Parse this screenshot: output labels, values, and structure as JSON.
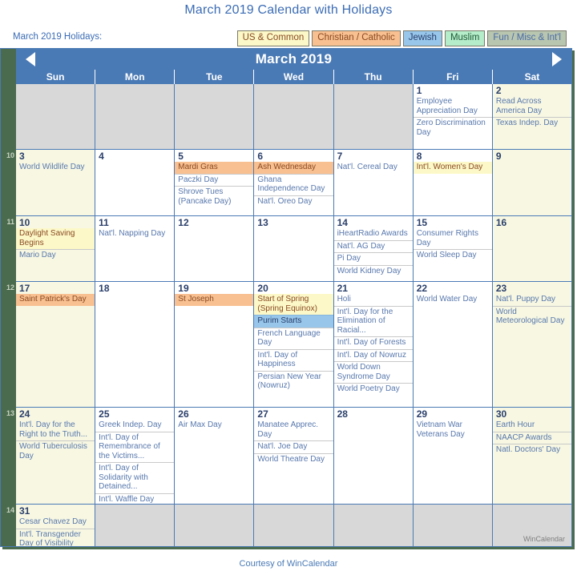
{
  "page": {
    "title": "March 2019 Calendar with Holidays",
    "footer": "Courtesy of WinCalendar",
    "watermark": "WinCalendar"
  },
  "legend": {
    "label": "March 2019 Holidays:",
    "chips": [
      {
        "label": "US & Common",
        "bg": "#fcf8c8",
        "fg": "#8a4a22",
        "key": "us"
      },
      {
        "label": "Christian / Catholic",
        "bg": "#f8c091",
        "fg": "#8a4a22",
        "key": "catholic"
      },
      {
        "label": "Jewish",
        "bg": "#97c6ea",
        "fg": "#2a3f6b",
        "key": "jewish"
      },
      {
        "label": "Muslim",
        "bg": "#b5ecc9",
        "fg": "#1f5a38",
        "key": "muslim"
      },
      {
        "label": "Fun / Misc & Int'l",
        "bg": "#b8c6b0",
        "fg": "#4a6ba8",
        "key": "fun"
      }
    ]
  },
  "header": {
    "month_title": "March 2019",
    "prev_label": "◀",
    "next_label": "▶"
  },
  "weekdays": [
    "Sun",
    "Mon",
    "Tue",
    "Wed",
    "Thu",
    "Fri",
    "Sat"
  ],
  "week_numbers": [
    "",
    "10",
    "11",
    "12",
    "13",
    "14"
  ],
  "weeks": [
    {
      "height_class": "w0",
      "days": [
        {
          "num": "",
          "blank": true,
          "weekend": true,
          "events": []
        },
        {
          "num": "",
          "blank": true,
          "events": []
        },
        {
          "num": "",
          "blank": true,
          "events": []
        },
        {
          "num": "",
          "blank": true,
          "events": []
        },
        {
          "num": "",
          "blank": true,
          "events": []
        },
        {
          "num": "1",
          "events": [
            {
              "text": "Employee Appreciation Day",
              "hl": ""
            },
            {
              "text": "Zero Discrimination Day",
              "hl": ""
            }
          ]
        },
        {
          "num": "2",
          "weekend": true,
          "events": [
            {
              "text": "Read Across America Day",
              "hl": ""
            },
            {
              "text": "Texas Indep. Day",
              "hl": ""
            }
          ]
        }
      ]
    },
    {
      "height_class": "w1",
      "days": [
        {
          "num": "3",
          "weekend": true,
          "events": [
            {
              "text": "World Wildlife Day",
              "hl": ""
            }
          ]
        },
        {
          "num": "4",
          "events": []
        },
        {
          "num": "5",
          "events": [
            {
              "text": "Mardi Gras",
              "hl": "catholic"
            },
            {
              "text": "Paczki Day",
              "hl": ""
            },
            {
              "text": "Shrove Tues (Pancake Day)",
              "hl": ""
            }
          ]
        },
        {
          "num": "6",
          "events": [
            {
              "text": "Ash Wednesday",
              "hl": "catholic"
            },
            {
              "text": "Ghana Independence Day",
              "hl": ""
            },
            {
              "text": "Nat'l. Oreo Day",
              "hl": ""
            }
          ]
        },
        {
          "num": "7",
          "events": [
            {
              "text": "Nat'l. Cereal Day",
              "hl": ""
            }
          ]
        },
        {
          "num": "8",
          "events": [
            {
              "text": "Int'l. Women's Day",
              "hl": "us"
            }
          ]
        },
        {
          "num": "9",
          "weekend": true,
          "events": []
        }
      ]
    },
    {
      "height_class": "w2",
      "days": [
        {
          "num": "10",
          "weekend": true,
          "events": [
            {
              "text": "Daylight Saving Begins",
              "hl": "us"
            },
            {
              "text": "Mario Day",
              "hl": ""
            }
          ]
        },
        {
          "num": "11",
          "events": [
            {
              "text": "Nat'l. Napping Day",
              "hl": ""
            }
          ]
        },
        {
          "num": "12",
          "events": []
        },
        {
          "num": "13",
          "events": []
        },
        {
          "num": "14",
          "events": [
            {
              "text": "iHeartRadio Awards",
              "hl": ""
            },
            {
              "text": "Nat'l. AG Day",
              "hl": ""
            },
            {
              "text": "Pi Day",
              "hl": ""
            },
            {
              "text": "World Kidney Day",
              "hl": ""
            }
          ]
        },
        {
          "num": "15",
          "events": [
            {
              "text": "Consumer Rights Day",
              "hl": ""
            },
            {
              "text": "World Sleep Day",
              "hl": ""
            }
          ]
        },
        {
          "num": "16",
          "weekend": true,
          "events": []
        }
      ]
    },
    {
      "height_class": "w3",
      "days": [
        {
          "num": "17",
          "weekend": true,
          "events": [
            {
              "text": "Saint Patrick's Day",
              "hl": "catholic"
            }
          ]
        },
        {
          "num": "18",
          "events": []
        },
        {
          "num": "19",
          "events": [
            {
              "text": "St Joseph",
              "hl": "catholic"
            }
          ]
        },
        {
          "num": "20",
          "events": [
            {
              "text": "Start of Spring (Spring Equinox)",
              "hl": "us"
            },
            {
              "text": "Purim Starts",
              "hl": "jewish"
            },
            {
              "text": "French Language Day",
              "hl": ""
            },
            {
              "text": "Int'l. Day of Happiness",
              "hl": ""
            },
            {
              "text": "Persian New Year (Nowruz)",
              "hl": ""
            }
          ]
        },
        {
          "num": "21",
          "events": [
            {
              "text": "Holi",
              "hl": ""
            },
            {
              "text": "Int'l. Day for the Elimination of Racial...",
              "hl": ""
            },
            {
              "text": "Int'l. Day of Forests",
              "hl": ""
            },
            {
              "text": "Int'l. Day of Nowruz",
              "hl": ""
            },
            {
              "text": "World Down Syndrome Day",
              "hl": ""
            },
            {
              "text": "World Poetry Day",
              "hl": ""
            }
          ]
        },
        {
          "num": "22",
          "events": [
            {
              "text": "World Water Day",
              "hl": ""
            }
          ]
        },
        {
          "num": "23",
          "weekend": true,
          "events": [
            {
              "text": "Nat'l. Puppy Day",
              "hl": ""
            },
            {
              "text": "World Meteorological Day",
              "hl": ""
            }
          ]
        }
      ]
    },
    {
      "height_class": "w4",
      "days": [
        {
          "num": "24",
          "weekend": true,
          "events": [
            {
              "text": "Int'l. Day for the Right to the Truth...",
              "hl": ""
            },
            {
              "text": "World Tuberculosis Day",
              "hl": ""
            }
          ]
        },
        {
          "num": "25",
          "events": [
            {
              "text": "Greek Indep. Day",
              "hl": ""
            },
            {
              "text": "Int'l. Day of Remembrance of the Victims...",
              "hl": ""
            },
            {
              "text": "Int'l. Day of Solidarity with Detained...",
              "hl": ""
            },
            {
              "text": "Int'l. Waffle Day",
              "hl": ""
            }
          ]
        },
        {
          "num": "26",
          "events": [
            {
              "text": "Air Max Day",
              "hl": ""
            }
          ]
        },
        {
          "num": "27",
          "events": [
            {
              "text": "Manatee Apprec. Day",
              "hl": ""
            },
            {
              "text": "Nat'l. Joe Day",
              "hl": ""
            },
            {
              "text": "World Theatre Day",
              "hl": ""
            }
          ]
        },
        {
          "num": "28",
          "events": []
        },
        {
          "num": "29",
          "events": [
            {
              "text": "Vietnam War Veterans Day",
              "hl": ""
            }
          ]
        },
        {
          "num": "30",
          "weekend": true,
          "events": [
            {
              "text": "Earth Hour",
              "hl": ""
            },
            {
              "text": "NAACP Awards",
              "hl": ""
            },
            {
              "text": "Natl. Doctors' Day",
              "hl": ""
            }
          ]
        }
      ]
    },
    {
      "height_class": "w5",
      "days": [
        {
          "num": "31",
          "weekend": true,
          "events": [
            {
              "text": "Cesar Chavez Day",
              "hl": ""
            },
            {
              "text": "Int'l. Transgender Day of Visibility",
              "hl": ""
            }
          ]
        },
        {
          "num": "",
          "blank": true,
          "events": []
        },
        {
          "num": "",
          "blank": true,
          "events": []
        },
        {
          "num": "",
          "blank": true,
          "events": []
        },
        {
          "num": "",
          "blank": true,
          "events": []
        },
        {
          "num": "",
          "blank": true,
          "events": []
        },
        {
          "num": "",
          "blank": true,
          "events": [],
          "watermark": true
        }
      ]
    }
  ]
}
